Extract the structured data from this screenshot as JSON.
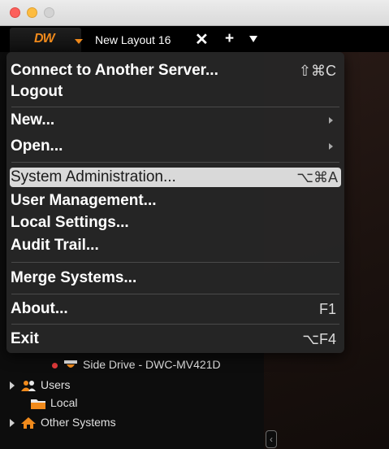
{
  "tabbar": {
    "logo": "DW",
    "tab_label": "New Layout 16",
    "close_glyph": "✕",
    "add_glyph": "+"
  },
  "menu": {
    "items": [
      {
        "label": "Connect to Another Server...",
        "shortcut": "⇧⌘C"
      },
      {
        "label": "Logout",
        "shortcut": ""
      },
      {
        "label": "New...",
        "shortcut": "",
        "submenu": true
      },
      {
        "label": "Open...",
        "shortcut": "",
        "submenu": true
      },
      {
        "label": "System Administration...",
        "shortcut": "⌥⌘A",
        "highlighted": true
      },
      {
        "label": "User Management...",
        "shortcut": ""
      },
      {
        "label": "Local Settings...",
        "shortcut": ""
      },
      {
        "label": "Audit Trail...",
        "shortcut": ""
      },
      {
        "label": "Merge Systems...",
        "shortcut": ""
      },
      {
        "label": "About...",
        "shortcut": "F1"
      },
      {
        "label": "Exit",
        "shortcut": "⌥F4"
      }
    ]
  },
  "tree": {
    "camera": "Side Drive - DWC-MV421D",
    "users": "Users",
    "local": "Local",
    "other_systems": "Other Systems"
  },
  "icons": {
    "collapse": "‹"
  },
  "colors": {
    "accent": "#f08a1c",
    "highlight": "#d9d9d9",
    "recording": "#e23a3a"
  }
}
